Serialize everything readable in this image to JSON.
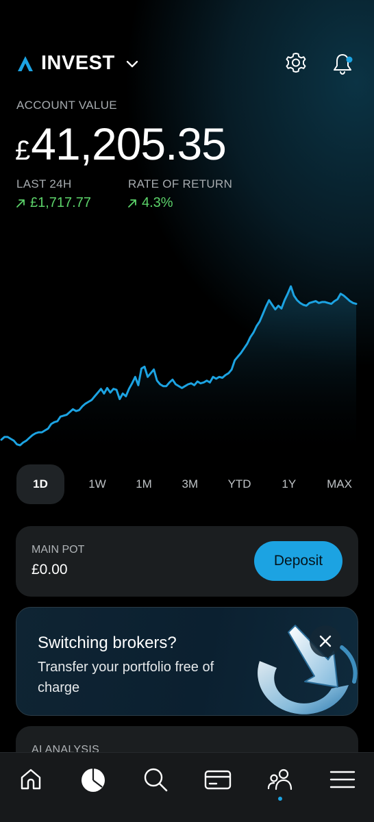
{
  "header": {
    "title": "INVEST",
    "settings_icon": "gear-icon",
    "notifications_icon": "bell-icon"
  },
  "account": {
    "label": "ACCOUNT VALUE",
    "currency": "£",
    "value": "41,205.35",
    "last24h_label": "LAST 24H",
    "last24h_value": "£1,717.77",
    "return_label": "RATE OF RETURN",
    "return_value": "4.3%"
  },
  "chart_data": {
    "type": "area",
    "title": "",
    "xlabel": "",
    "ylabel": "",
    "grid": false,
    "line_color": "#1ca3e2",
    "values": [
      2,
      5,
      5,
      3,
      1,
      -3,
      -4,
      -1,
      1,
      4,
      7,
      9,
      10,
      10,
      12,
      14,
      19,
      21,
      22,
      27,
      28,
      29,
      32,
      35,
      33,
      34,
      38,
      41,
      43,
      45,
      49,
      53,
      57,
      52,
      58,
      53,
      57,
      56,
      46,
      52,
      49,
      57,
      63,
      70,
      61,
      79,
      81,
      70,
      74,
      78,
      66,
      62,
      60,
      60,
      64,
      67,
      62,
      60,
      58,
      60,
      62,
      63,
      61,
      65,
      63,
      64,
      66,
      64,
      70,
      68,
      70,
      69,
      72,
      74,
      78,
      88,
      92,
      96,
      101,
      106,
      113,
      118,
      125,
      130,
      138,
      146,
      153,
      148,
      143,
      147,
      144,
      153,
      160,
      168,
      158,
      153,
      150,
      148,
      147,
      150,
      151,
      152,
      150,
      151,
      151,
      150,
      149,
      152,
      154,
      160,
      158,
      155,
      152,
      150,
      149
    ]
  },
  "ranges": {
    "items": [
      "1D",
      "1W",
      "1M",
      "3M",
      "YTD",
      "1Y",
      "MAX"
    ],
    "active": "1D"
  },
  "main_pot": {
    "label": "MAIN POT",
    "value": "£0.00",
    "button_label": "Deposit"
  },
  "promo": {
    "title": "Switching brokers?",
    "text": "Transfer your portfolio free of charge"
  },
  "ai_analysis": {
    "label": "AI ANALYSIS"
  },
  "colors": {
    "accent": "#1ca3e2",
    "positive": "#5cd36a",
    "card": "#1b1e20"
  },
  "tabbar": {
    "items": [
      "home-icon",
      "portfolio-icon",
      "search-icon",
      "card-icon",
      "community-icon",
      "menu-icon"
    ],
    "active": "portfolio-icon"
  }
}
